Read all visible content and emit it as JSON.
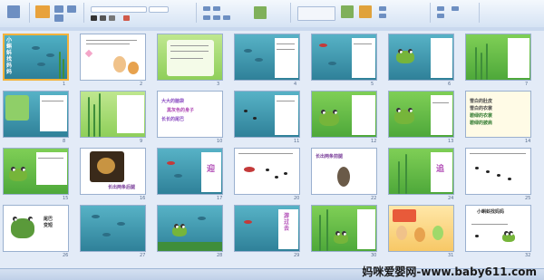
{
  "watermark": "妈咪爱婴网-www.baby611.com",
  "colors": {
    "ribbon": "#dbe6f5",
    "selection": "#f2b23c",
    "water": "#4fa6b8",
    "grass": "#9fd96a"
  },
  "slides": [
    {
      "n": "1",
      "title": "小蝌蚪找妈妈"
    },
    {
      "n": "2",
      "body": ""
    },
    {
      "n": "3",
      "body": ""
    },
    {
      "n": "4",
      "body": ""
    },
    {
      "n": "5",
      "body": ""
    },
    {
      "n": "6",
      "body": ""
    },
    {
      "n": "7",
      "body": ""
    },
    {
      "n": "8",
      "body": ""
    },
    {
      "n": "9",
      "body": ""
    },
    {
      "n": "10",
      "body": ""
    },
    {
      "n": "11",
      "lines": [
        "大大的脑袋",
        "黑灰色的身子",
        "长长的尾巴"
      ]
    },
    {
      "n": "12",
      "body": ""
    },
    {
      "n": "13",
      "body": ""
    },
    {
      "n": "14",
      "body": ""
    },
    {
      "n": "15",
      "lines": [
        "雪白的肚皮",
        "雪白的衣裳",
        "碧绿的衣裳",
        "碧绿的披肩"
      ]
    },
    {
      "n": "16",
      "body": ""
    },
    {
      "n": "17",
      "body": ""
    },
    {
      "n": "18",
      "caption": "长出两条后腿"
    },
    {
      "n": "19",
      "label": "迎"
    },
    {
      "n": "20",
      "body": ""
    },
    {
      "n": "21",
      "caption": "长出两条前腿"
    },
    {
      "n": "22",
      "body": ""
    },
    {
      "n": "23",
      "label": "追"
    },
    {
      "n": "24",
      "body": ""
    },
    {
      "n": "25",
      "caption": "尾巴变短"
    },
    {
      "n": "26",
      "body": ""
    },
    {
      "n": "27",
      "body": ""
    },
    {
      "n": "28",
      "label": "游过去"
    },
    {
      "n": "29",
      "body": ""
    },
    {
      "n": "30",
      "label": "蹦"
    },
    {
      "n": "31",
      "body": ""
    },
    {
      "n": "32",
      "caption": "小蝌蚪找妈妈"
    }
  ]
}
